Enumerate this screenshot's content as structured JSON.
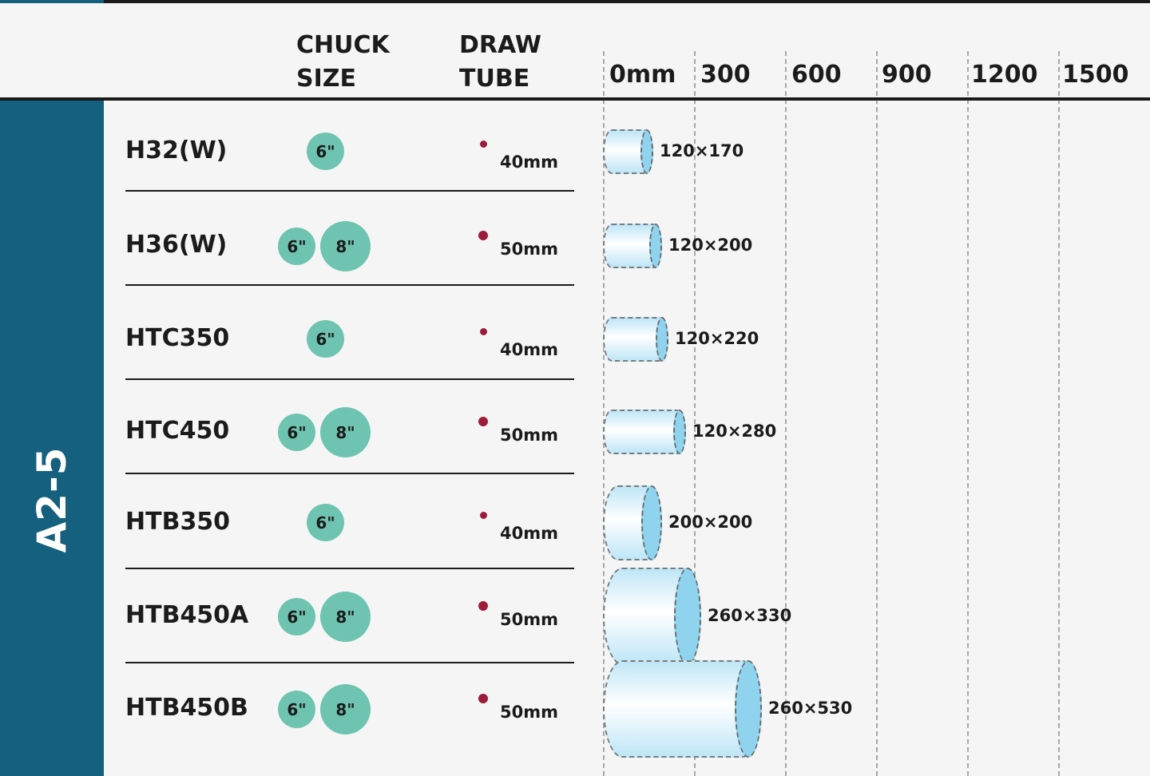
{
  "sidebar": {
    "label": "A2-5"
  },
  "header": {
    "chuck_size": [
      "CHUCK",
      "SIZE"
    ],
    "draw_tube": [
      "DRAW",
      "TUBE"
    ],
    "scale": [
      "0mm",
      "300",
      "600",
      "900",
      "1200",
      "1500"
    ]
  },
  "rows": [
    {
      "model": "H32(W)",
      "chucks": [
        "6\""
      ],
      "draw_tube": "40mm",
      "dims": "120×170"
    },
    {
      "model": "H36(W)",
      "chucks": [
        "6\"",
        "8\""
      ],
      "draw_tube": "50mm",
      "dims": "120×200"
    },
    {
      "model": "HTC350",
      "chucks": [
        "6\""
      ],
      "draw_tube": "40mm",
      "dims": "120×220"
    },
    {
      "model": "HTC450",
      "chucks": [
        "6\"",
        "8\""
      ],
      "draw_tube": "50mm",
      "dims": "120×280"
    },
    {
      "model": "HTB350",
      "chucks": [
        "6\""
      ],
      "draw_tube": "40mm",
      "dims": "200×200"
    },
    {
      "model": "HTB450A",
      "chucks": [
        "6\"",
        "8\""
      ],
      "draw_tube": "50mm",
      "dims": "260×330"
    },
    {
      "model": "HTB450B",
      "chucks": [
        "6\"",
        "8\""
      ],
      "draw_tube": "50mm",
      "dims": "260×530"
    }
  ],
  "colors": {
    "sidebar": "#14607e",
    "chuck_badge": "#6ec4b1",
    "draw_tube_dot": "#9c1b3a",
    "cylinder_cap": "#8fd3ee"
  }
}
